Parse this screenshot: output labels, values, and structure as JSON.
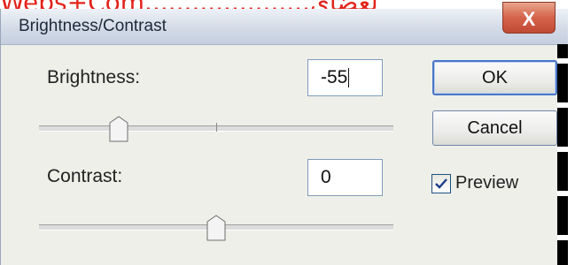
{
  "overlay": {
    "text": "Webs+Com.....................لعضاي"
  },
  "dialog": {
    "title": "Brightness/Contrast",
    "close_glyph": "X",
    "brightness": {
      "label": "Brightness:",
      "value": "-55",
      "slider_fraction": 0.225
    },
    "contrast": {
      "label": "Contrast:",
      "value": "0",
      "slider_fraction": 0.5
    },
    "buttons": {
      "ok": "OK",
      "cancel": "Cancel"
    },
    "preview": {
      "label": "Preview",
      "checked": true
    }
  },
  "colors": {
    "accent": "#4a76c6",
    "close": "#d5634a",
    "overlay": "#e2231a"
  }
}
